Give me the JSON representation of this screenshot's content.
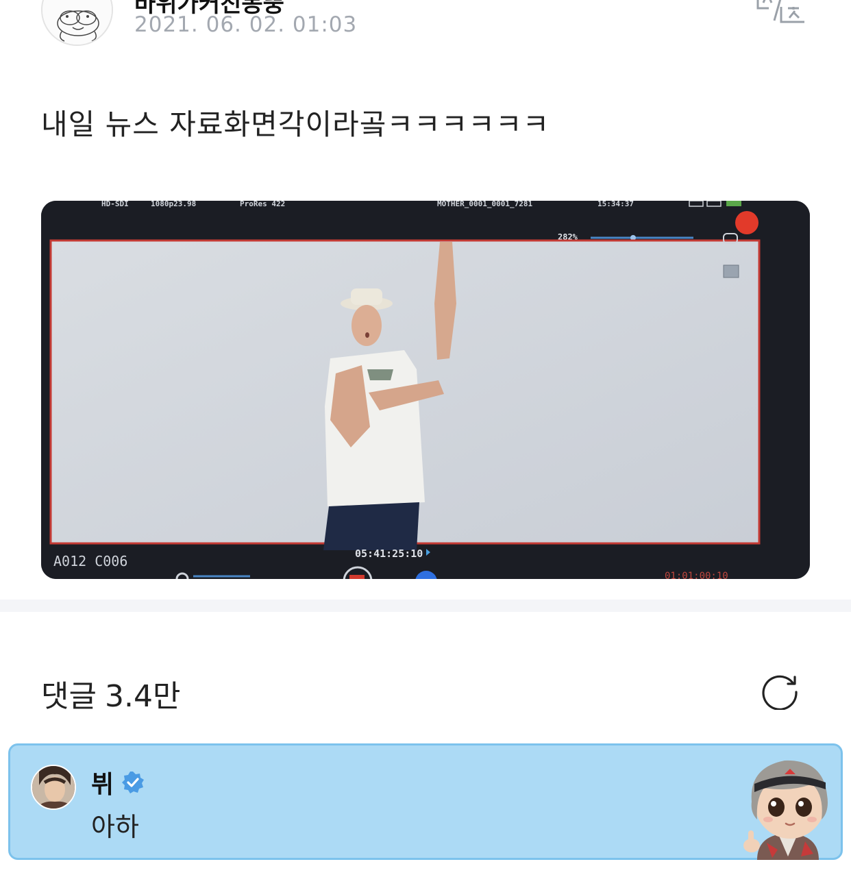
{
  "post": {
    "author_name": "바위가커진몽뚱",
    "date": "2021. 06. 02. 01:03",
    "text": "내일 뉴스 자료화면각이라곸ㅋㅋㅋㅋㅋㅋ"
  },
  "media": {
    "overlay_top": [
      "HD-SDI",
      "1080p23.98",
      "ProRes 422",
      "MOTHER_0001_0001_7281",
      "15:34:37"
    ],
    "zoom_label": "282%",
    "clip_label": "A012  C006",
    "timecode": "05:41:25:10"
  },
  "comments": {
    "label": "댓글",
    "count": "3.4만",
    "items": [
      {
        "author": "뷔",
        "text": "아하"
      }
    ]
  },
  "icons": {
    "translate": "translate-icon",
    "refresh": "refresh-icon",
    "verified": "verified-badge-icon"
  },
  "colors": {
    "highlight_bg": "#acdaf5",
    "highlight_border": "#7cc2ec",
    "verified": "#4a9be4",
    "date_text": "#a3a8b0"
  }
}
